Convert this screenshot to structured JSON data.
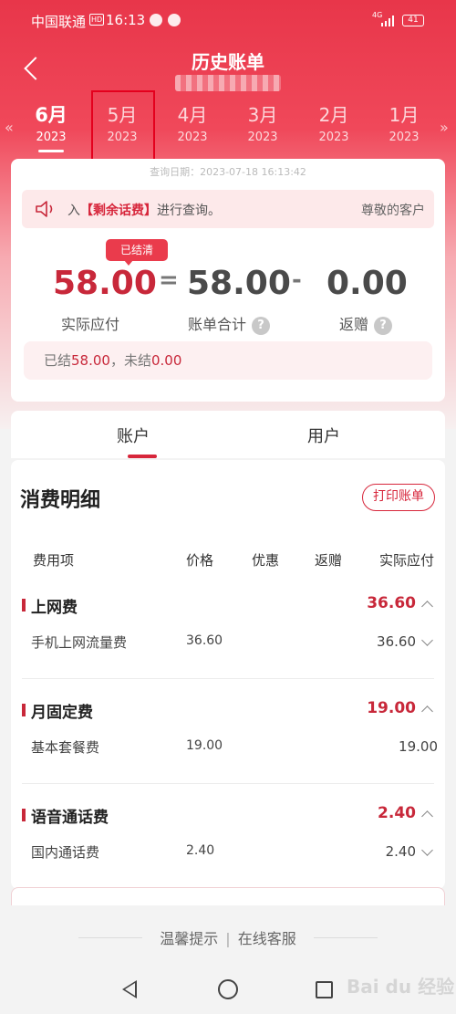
{
  "status_bar": {
    "carrier": "中国联通",
    "hd": "HD",
    "time": "16:13",
    "network": "4G",
    "battery": "41"
  },
  "header": {
    "title": "历史账单",
    "back_icon": "chevron-left-icon"
  },
  "months": [
    {
      "month": "6月",
      "year": "2023",
      "active": true
    },
    {
      "month": "5月",
      "year": "2023",
      "active": false
    },
    {
      "month": "4月",
      "year": "2023",
      "active": false
    },
    {
      "month": "3月",
      "year": "2023",
      "active": false
    },
    {
      "month": "2月",
      "year": "2023",
      "active": false
    },
    {
      "month": "1月",
      "year": "2023",
      "active": false
    }
  ],
  "query_date": "查询日期：2023-07-18 16:13:42",
  "notice": {
    "prefix": "入",
    "keyword": "【剩余话费】",
    "suffix": "进行查询。",
    "tail": "尊敬的客户"
  },
  "summary": {
    "status_badge": "已结清",
    "actual_due": "58.00",
    "actual_due_label": "实际应付",
    "equals": "=",
    "bill_total": "58.00",
    "bill_total_label": "账单合计",
    "minus": "-",
    "rebate": "0.00",
    "rebate_label": "返赠",
    "help": "?"
  },
  "settled": {
    "prefix": "已结",
    "settled_amount": "58.00",
    "mid": "，未结",
    "unsettled_amount": "0.00"
  },
  "tabs": {
    "account": "账户",
    "user": "用户"
  },
  "details": {
    "title": "消费明细",
    "print_button": "打印账单",
    "columns": [
      "费用项",
      "价格",
      "优惠",
      "返赠",
      "实际应付"
    ],
    "sections": [
      {
        "name": "上网费",
        "amount": "36.60",
        "item": "手机上网流量费",
        "price": "36.60",
        "item_amount": "36.60"
      },
      {
        "name": "月固定费",
        "amount": "19.00",
        "item": "基本套餐费",
        "price": "19.00",
        "item_amount": "19.00"
      },
      {
        "name": "语音通话费",
        "amount": "2.40",
        "item": "国内通话费",
        "price": "2.40",
        "item_amount": "2.40"
      }
    ]
  },
  "footer": {
    "tips": "温馨提示",
    "separator": "|",
    "service": "在线客服"
  },
  "watermark": "Bai du 经验",
  "colors": {
    "brand_red": "#e8364a",
    "amount_red": "#c8283a",
    "highlight_box": "#e4001d"
  }
}
